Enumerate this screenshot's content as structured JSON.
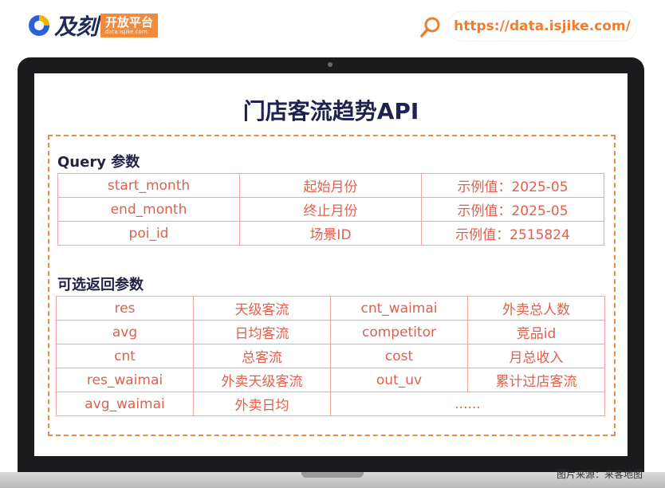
{
  "brand": {
    "logo_text": "及刻",
    "tag_main": "开放平台",
    "tag_sub": "data.isjike.com",
    "url": "https://data.isjike.com/"
  },
  "title": "门店客流趋势API",
  "query_section": {
    "heading": "Query 参数",
    "rows": [
      {
        "name": "start_month",
        "desc": "起始月份",
        "example": "示例值：2025-05"
      },
      {
        "name": "end_month",
        "desc": "终止月份",
        "example": "示例值：2025-05"
      },
      {
        "name": "poi_id",
        "desc": "场景ID",
        "example": "示例值：2515824"
      }
    ]
  },
  "return_section": {
    "heading": "可选返回参数",
    "rows": [
      [
        "res",
        "天级客流",
        "cnt_waimai",
        "外卖总人数"
      ],
      [
        "avg",
        "日均客流",
        "competitor",
        "竞品id"
      ],
      [
        "cnt",
        "总客流",
        "cost",
        "月总收入"
      ],
      [
        "res_waimai",
        "外卖天级客流",
        "out_uv",
        "累计过店客流"
      ],
      [
        "avg_waimai",
        "外卖日均",
        "......"
      ]
    ]
  },
  "source_credit": "图片来源：来客地图",
  "colors": {
    "accent": "#f08a3c",
    "table_text": "#e0604f",
    "table_border": "#f0a79a",
    "title": "#1f2150",
    "frame": "#1b1b1d"
  }
}
